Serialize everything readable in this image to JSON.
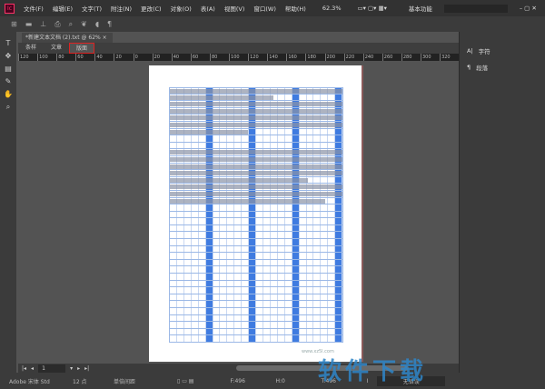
{
  "menubar": {
    "items": [
      "文件(F)",
      "编辑(E)",
      "文字(T)",
      "附注(N)",
      "更改(C)",
      "对象(O)",
      "表(A)",
      "视图(V)",
      "窗口(W)",
      "帮助(H)"
    ],
    "zoom": "62.3%",
    "workspace": "基本功能"
  },
  "document": {
    "tab_title": "*新建文本文档 (2).txt @ 62%",
    "close": "×",
    "view_tabs": [
      "条样",
      "文章",
      "版面"
    ],
    "active_view": "版面",
    "ruler_ticks": [
      "120",
      "100",
      "80",
      "60",
      "40",
      "20",
      "0",
      "20",
      "40",
      "60",
      "80",
      "100",
      "120",
      "140",
      "160",
      "180",
      "200",
      "220",
      "240",
      "260",
      "280",
      "300",
      "320"
    ],
    "page_watermark": "www.xz5l.com"
  },
  "right_panel": {
    "items": [
      {
        "icon": "character-icon",
        "label": "字符"
      },
      {
        "icon": "paragraph-icon",
        "label": "段落"
      }
    ]
  },
  "page_nav": {
    "page": "1"
  },
  "bottom": {
    "font": "Adobe 宋体 Std",
    "size": "12 点",
    "leading": "单倍间距",
    "f": "F:496",
    "h": "H:0",
    "t": "T:496",
    "status": "无错误"
  },
  "watermark": {
    "text": "软件下载"
  },
  "colors": {
    "accent": "#3f7be0",
    "highlight": "#d22222"
  }
}
